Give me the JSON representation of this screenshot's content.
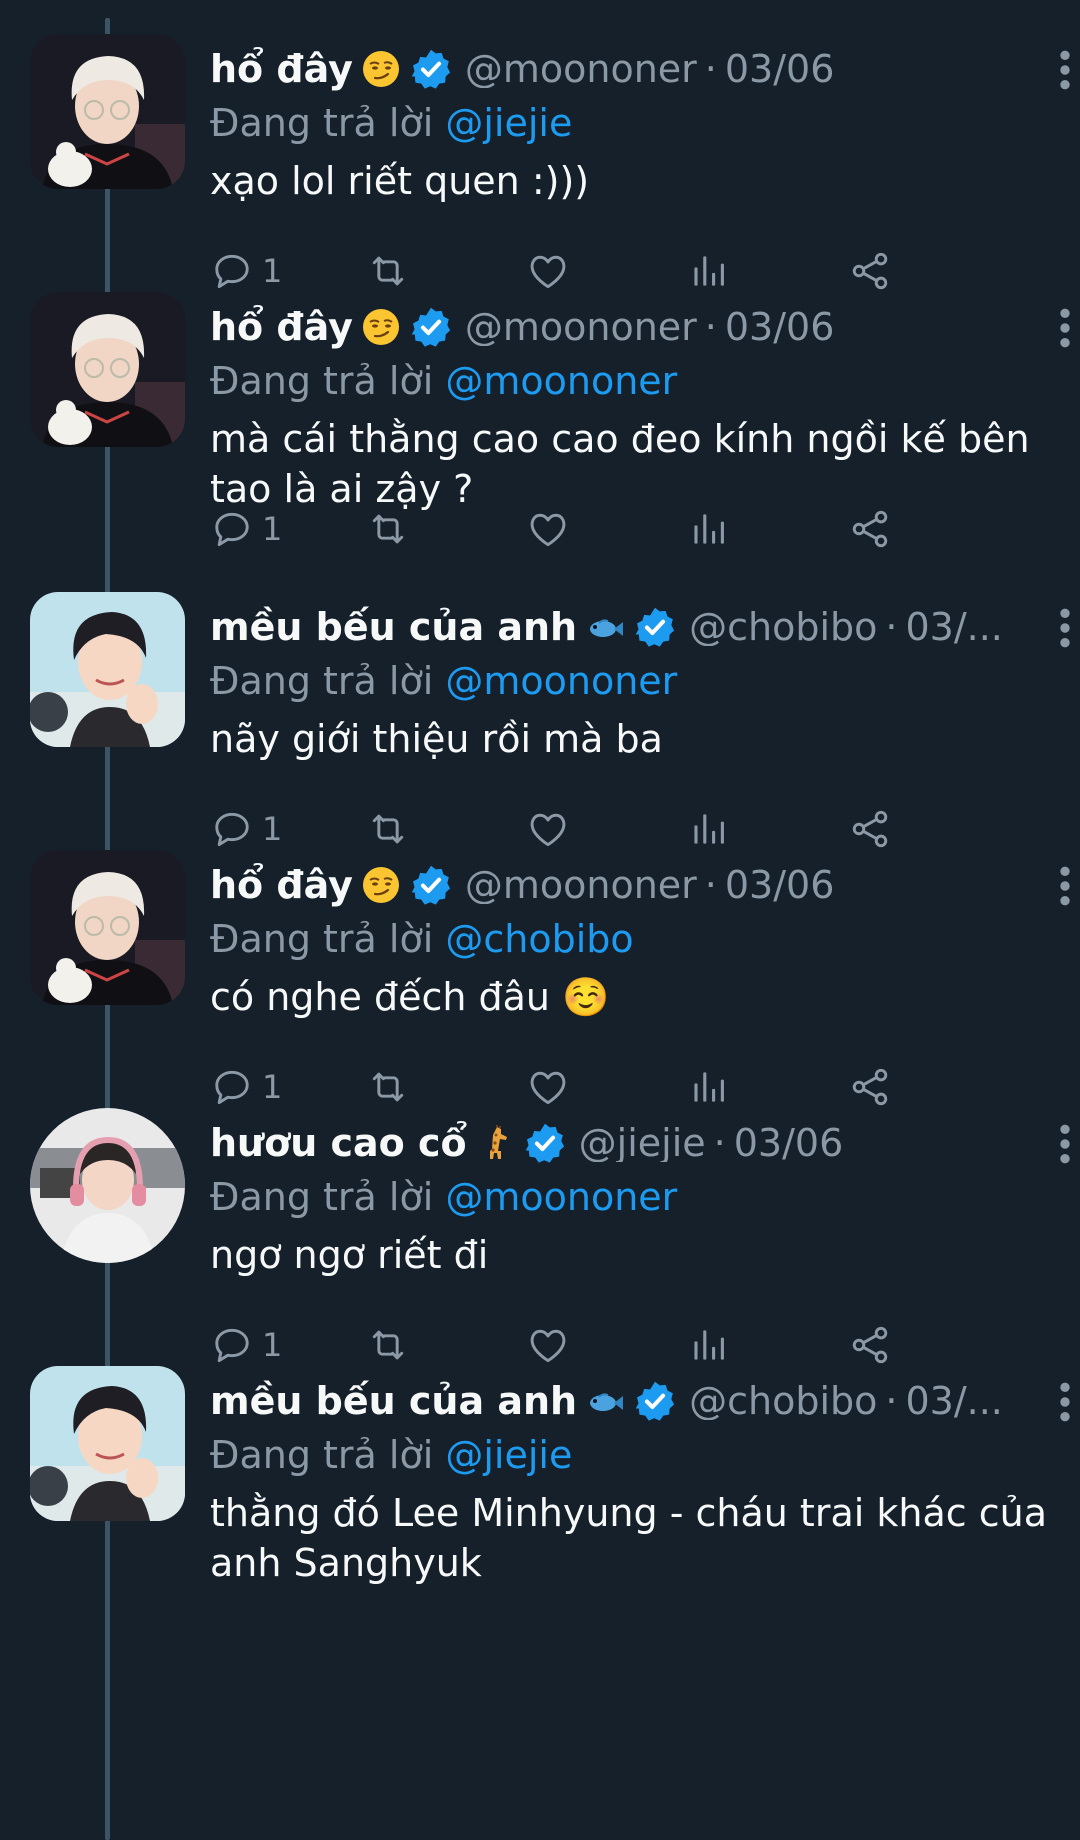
{
  "reply_prefix": "Đang trả lời",
  "tweets": [
    {
      "name": "hổ đây",
      "emoji": "smirking-face-emoji",
      "handle": "@moononer",
      "separator": "·",
      "date": "03/06",
      "reply_to": "@jiejie",
      "text": "xạo lol riết quen :)))",
      "reply_count": "1",
      "avatar": "blond-glasses-avatar"
    },
    {
      "name": "hổ đây",
      "emoji": "smirking-face-emoji",
      "handle": "@moononer",
      "separator": "·",
      "date": "03/06",
      "reply_to": "@moononer",
      "text": "mà cái thằng cao cao đeo kính ngồi kế bên tao là ai zậy ?",
      "reply_count": "1",
      "avatar": "blond-glasses-avatar"
    },
    {
      "name": "mều bếu của anh",
      "emoji": "fish-emoji",
      "handle": "@chobibo",
      "separator": "·",
      "date": "03/...",
      "reply_to": "@moononer",
      "text": "nãy giới thiệu rồi mà ba",
      "reply_count": "1",
      "avatar": "dark-hair-smiling-avatar"
    },
    {
      "name": "hổ đây",
      "emoji": "smirking-face-emoji",
      "handle": "@moononer",
      "separator": "·",
      "date": "03/06",
      "reply_to": "@chobibo",
      "text": "có nghe đếch đâu ☺️",
      "reply_count": "1",
      "avatar": "blond-glasses-avatar"
    },
    {
      "name": "hươu cao cổ",
      "emoji": "giraffe-emoji",
      "handle": "@jiejie",
      "separator": "·",
      "date": "03/06",
      "reply_to": "@moononer",
      "text": "ngơ ngơ riết đi",
      "reply_count": "1",
      "avatar": "headset-avatar"
    },
    {
      "name": "mều bếu của anh",
      "emoji": "fish-emoji",
      "handle": "@chobibo",
      "separator": "·",
      "date": "03/...",
      "reply_to": "@jiejie",
      "text": "thằng đó Lee Minhyung - cháu trai khác của anh Sanghyuk",
      "reply_count": "1",
      "avatar": "dark-hair-smiling-avatar"
    }
  ],
  "icons": {
    "more": "more-vertical-icon",
    "verified": "verified-badge-icon",
    "reply": "reply-icon",
    "retweet": "retweet-icon",
    "like": "like-icon",
    "views": "views-icon",
    "share": "share-icon"
  },
  "colors": {
    "background": "#15202b",
    "text": "#f7f9f9",
    "muted": "#8b98a5",
    "mention": "#1d9bf0",
    "verified": "#1d9bf0",
    "thread_line": "#3d5466"
  }
}
